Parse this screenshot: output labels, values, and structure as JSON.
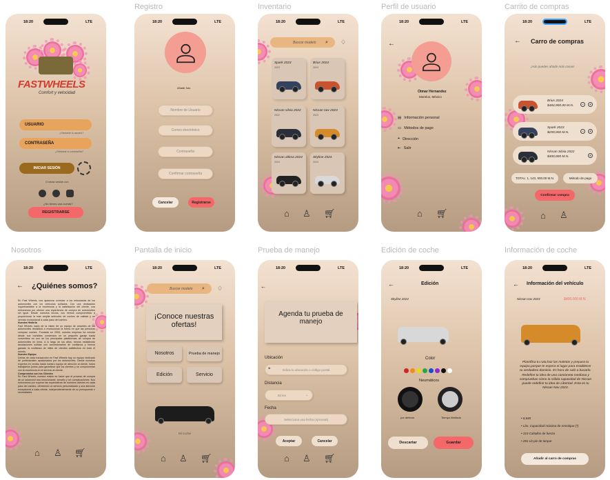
{
  "screens": {
    "login": {
      "label": "",
      "time": "18:20",
      "carrier": "LTE",
      "brand": "FASTWHEELS",
      "tagline": "Comfort y velocidad",
      "user": "USUARIO",
      "user_hint": "¿Olvidaste tu usuario?",
      "pass": "CONTRASEÑA",
      "pass_hint": "¿Olvidaste tu contraseña?",
      "login": "INICIAR SESIÓN",
      "alt": "O inicia sesión con",
      "no_account": "¿No tienes una cuenta?",
      "register": "REGISTRARSE"
    },
    "registro": {
      "label": "Registro",
      "time": "18:20",
      "carrier": "LTE",
      "add_photo": "Añadir foto",
      "f1": "Nombre de Usuario",
      "f2": "Correo electrónico",
      "f3": "Contraseña",
      "f4": "Confirmar contraseña",
      "cancel": "Cancelar",
      "submit": "Registrarse"
    },
    "inventario": {
      "label": "Inventario",
      "time": "18:20",
      "carrier": "LTE",
      "search": "Buscar modelo",
      "cars": [
        {
          "name": "Spark 2023",
          "year": "2023"
        },
        {
          "name": "Brius 2024",
          "year": "2024"
        },
        {
          "name": "Nissan silvia 2022",
          "year": "2022"
        },
        {
          "name": "Nissan nav 2023",
          "year": "2023"
        },
        {
          "name": "Nissan altima 2024",
          "year": "2024"
        },
        {
          "name": "Skyline 2024",
          "year": "2024"
        }
      ]
    },
    "perfil": {
      "label": "Perfil de usuario",
      "time": "18:20",
      "carrier": "LTE",
      "name": "Otmar Hernandez",
      "city": "Morelos, México",
      "items": [
        "Información personal",
        "Métodos de pago",
        "Dirección",
        "Salir"
      ]
    },
    "carrito": {
      "label": "Carrito de compras",
      "time": "18:20",
      "carrier": "LTE",
      "title": "Carro de compras",
      "hint": "¡Aún puedes añadir más cosas!",
      "items": [
        {
          "name": "Brius 2024",
          "price": "$484,900.00 M.N.",
          "qty": "1"
        },
        {
          "name": "Spark 2023",
          "price": "$259,000 M.N.",
          "qty": "1"
        },
        {
          "name": "Nissan Silvia 2022",
          "price": "$400,000 M.N.",
          "qty": "1"
        }
      ],
      "total": "TOTAL: 1, 143, 900.00 M.N.",
      "method": "Método de pago",
      "confirm": "Confirmar compra"
    },
    "nosotros": {
      "label": "Nosotros",
      "time": "18:20",
      "carrier": "LTE",
      "title": "¿Quiénes somos?",
      "p1": "En Fast Wheels, nos apasiona conectar a los entusiastas de los automóviles con los vehículos soñados. Con una dedicación inquebrantable a la excelencia y la satisfacción del cliente, nos esforzamos por ofrecer una experiencia de compra de automóviles sin igual. Desde nuestros inicios, nos hemos comprometido a proporcionar la más amplia selección de coches de calidad y un servicio excepcional a cada paso del camino.",
      "h1": "Nuestra Historia",
      "p2": "Fast Wheels nació de la visión de un equipo de amantes de los automóviles decididos a revolucionar la forma en que las personas compran coches. Fundada en 2005, nuestra empresa ha crecido desde sus humildes comienzos en un pequeño garaje hasta convertirse en uno de los principales plataformas de compra de automóviles en línea. A lo largo de los años, hemos establecido asociaciones sólidas con concesionarios de confianza y hemos ganado la confianza de miles de clientes satisfechos en todo el mundo.",
      "h2": "Nuestro Equipo",
      "p3": "Detrás de cada transacción en Fast Wheels hay un equipo dedicado de profesionales apasionados por los automóviles. Desde nuestros expertos en ventas hasta nuestro equipo de atención al cliente, todos trabajamos juntos para garantizar que los clientes y se comprometan con la excelencia en el servicio al cliente.",
      "h3": "Compromiso con los Clientes",
      "p4": "En Fast Wheels, nuestra misión es hacer que el proceso de compra de un automóvil sea emocionante, sencillo y sin complicaciones. Nos esforzamos por superar las expectativas de nuestros clientes en cada paso del camino, ofreciendo un servicio personalizado y una atención excepcional a cada cliente, independientemente de su presupuesto o necesidades."
    },
    "inicio": {
      "label": "Pantalla de inicio",
      "time": "18:20",
      "carrier": "LTE",
      "search": "Buscar modelo",
      "banner": "¡Conoce nuestras ofertas!",
      "b1": "Nosotros",
      "b2": "Prueba de manejo",
      "b3": "Edición",
      "b4": "Servicio",
      "car": "Mi coche"
    },
    "prueba": {
      "label": "Prueba de manejo",
      "time": "18:20",
      "carrier": "LTE",
      "title": "Agenda tu prueba de manejo",
      "loc_label": "Ubicación",
      "loc_ph": "Indica tu ubicación o código postal",
      "dist_label": "Distancia",
      "dist_val": "50 km",
      "date_label": "Fecha",
      "date_ph": "Selecciona una fecha (opcional)",
      "accept": "Aceptar",
      "cancel": "Cancelar"
    },
    "edicion": {
      "label": "Edición de coche",
      "time": "18:20",
      "carrier": "LTE",
      "title": "Edición",
      "model": "Skyline 2024",
      "color": "Color",
      "tires": "Neumáticos",
      "t1": "por defecto",
      "t2": "Tiempo ilimitado",
      "discard": "Descartar",
      "save": "Guardar"
    },
    "info": {
      "label": "Información de coche",
      "time": "18:20",
      "carrier": "LTE",
      "title": "Información del vehículo",
      "model": "Nissan nav 2023",
      "price": "$400,000 M.N.",
      "desc": "Plantífica tu ruta,haz las maletas y prepara tu equipo,porque te espera el lugar para establecer tu verdadero dominio. Es hora de salir a busarlo. Redefine tu idea de una camioneta mediana y compruebas cómo la sólida capacidad de Nissan puede redefinir tu idea de Libertad. Esta es tu Nissan Nav 2023.",
      "specs": [
        "6,640",
        "Lbs. Capacidad máxima de remolque (*)",
        "310 Caballos de fuerza",
        "281 Lb-pie de torque"
      ],
      "add": "Añadir al carro de compras"
    }
  },
  "colors": {
    "accent": "#f4686a",
    "orange": "#e8a35c",
    "brown": "#9a6a1e",
    "avatar": "#f49d92"
  }
}
